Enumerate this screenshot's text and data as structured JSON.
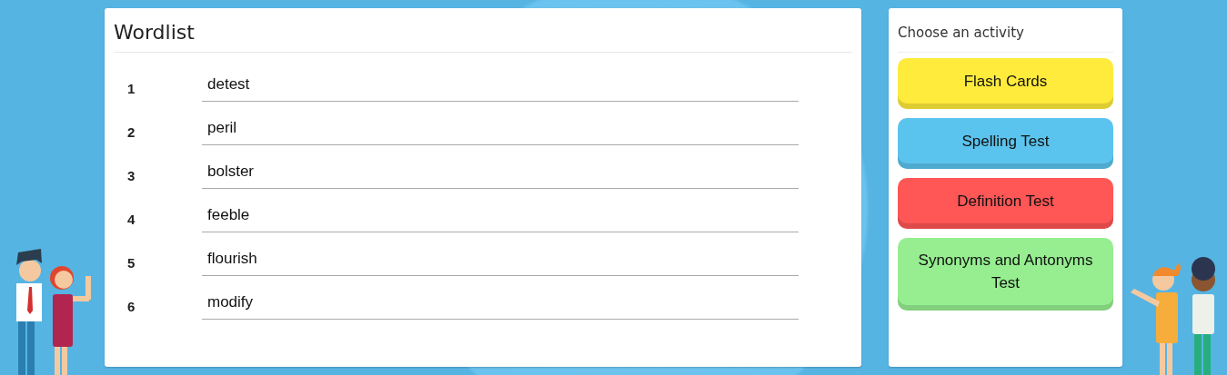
{
  "wordlist": {
    "title": "Wordlist",
    "words": [
      {
        "number": "1",
        "word": "detest"
      },
      {
        "number": "2",
        "word": "peril"
      },
      {
        "number": "3",
        "word": "bolster"
      },
      {
        "number": "4",
        "word": "feeble"
      },
      {
        "number": "5",
        "word": "flourish"
      },
      {
        "number": "6",
        "word": "modify"
      }
    ]
  },
  "activities": {
    "title": "Choose an activity",
    "buttons": [
      {
        "label": "Flash Cards",
        "color": "#ffeb3b"
      },
      {
        "label": "Spelling Test",
        "color": "#5bc4ee"
      },
      {
        "label": "Definition Test",
        "color": "#ff5656"
      },
      {
        "label": "Synonyms and Antonyms Test",
        "color": "#96ee90"
      }
    ]
  }
}
